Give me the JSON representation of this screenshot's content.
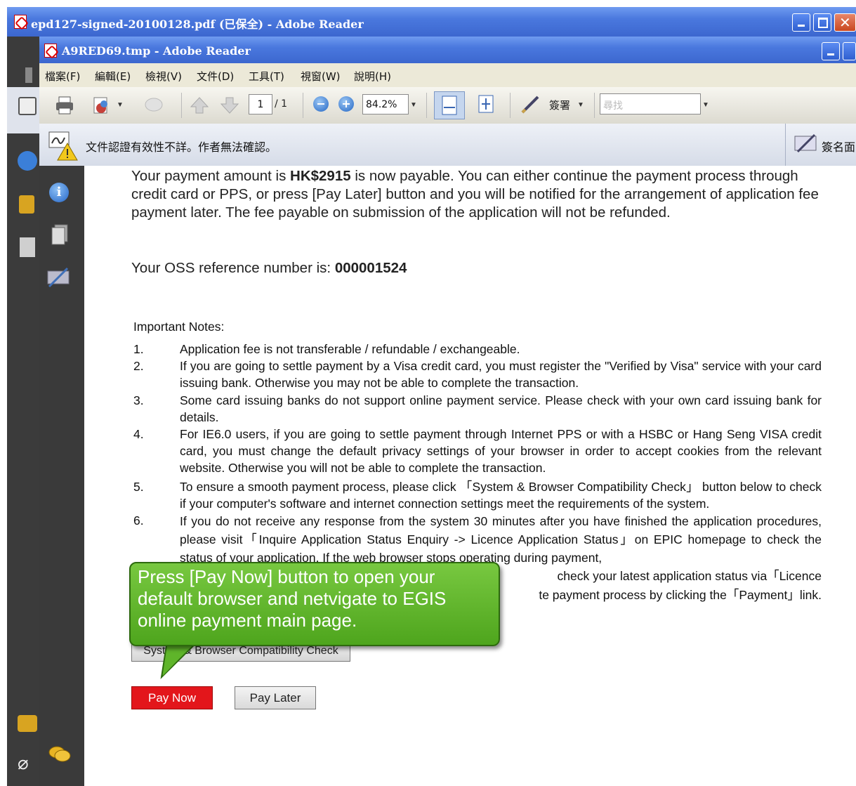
{
  "back_window": {
    "title": "epd127-signed-20100128.pdf (已保全) - Adobe Reader",
    "menu_partial": "檔案"
  },
  "front_window": {
    "title": "A9RED69.tmp - Adobe Reader"
  },
  "menubar": [
    "檔案(F)",
    "編輯(E)",
    "檢視(V)",
    "文件(D)",
    "工具(T)",
    "視窗(W)",
    "說明(H)"
  ],
  "toolbar": {
    "page_current": "1",
    "page_total": "/ 1",
    "zoom": "84.2%",
    "sign_label": "簽署",
    "search_placeholder": "尋找"
  },
  "signature_bar": {
    "message": "文件認證有效性不詳。作者無法確認。",
    "sign_panel": "簽名面"
  },
  "document": {
    "payment_para_1": "Your payment amount is ",
    "amount": "HK$2915",
    "payment_para_2": " is now payable. You can either continue the payment process through credit card or PPS, or press [Pay Later] button and you will be notified for the arrangement of application fee payment later. The fee payable on submission of the application will not be refunded.",
    "reference_label": "Your OSS reference number is: ",
    "reference_number": "000001524",
    "notes_heading": "Important Notes:",
    "notes": [
      {
        "num": "1.",
        "text": "Application fee is not transferable / refundable / exchangeable."
      },
      {
        "num": "2.",
        "text": "If you are going to settle payment by a Visa credit card, you must register the \"Verified by Visa\" service with your card issuing bank. Otherwise you may not be able to complete the transaction."
      },
      {
        "num": "3.",
        "text": "Some card issuing banks do not support online payment service. Please check with your own card issuing bank for details."
      },
      {
        "num": "4.",
        "text": "For IE6.0 users, if you are going to settle payment through Internet PPS or with a HSBC or Hang Seng VISA credit card, you must change the default privacy settings of your browser in order to accept cookies from the relevant website. Otherwise you will not be able to complete the transaction."
      },
      {
        "num": "5.",
        "text": "To ensure a smooth payment process, please click 「System & Browser Compatibility Check」 button below to check if your computer's software and internet connection settings meet the requirements of the system."
      },
      {
        "num": "6.",
        "text": "If you do not receive any response from the system 30 minutes after you have finished the application procedures, please visit「Inquire Application Status Enquiry -> Licence Application Status」on EPIC homepage to check the status of your application. If the web browser stops operating during payment,"
      }
    ],
    "note6_tail_1": "check your latest application status via「Licence",
    "note6_tail_2": "te payment process by clicking the「Payment」link.",
    "compat_button": "System & Browser Compatibility Check",
    "pay_now": "Pay Now",
    "pay_later": "Pay Later"
  },
  "callout": {
    "text": "Press [Pay Now] button to open your default browser and netvigate to EGIS online payment main page."
  },
  "colors": {
    "titlebar": "#3c67cf",
    "pay_now": "#e3161b",
    "callout": "#5fb52a"
  }
}
